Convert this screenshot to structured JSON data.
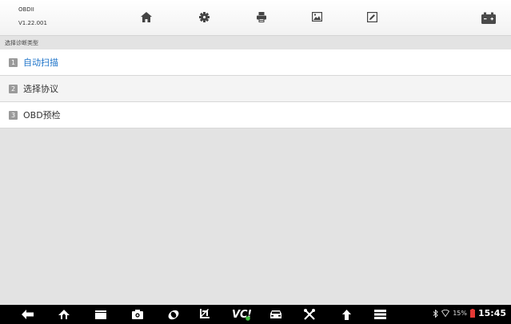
{
  "header": {
    "app_name": "OBDII",
    "app_version": "V1.22.001",
    "toolbar": [
      {
        "icon": "home-icon"
      },
      {
        "icon": "settings-icon"
      },
      {
        "icon": "print-icon"
      },
      {
        "icon": "screenshot-icon"
      },
      {
        "icon": "edit-note-icon"
      }
    ],
    "battery_icon": "vehicle-battery-icon"
  },
  "subtitle": "选择诊断类型",
  "menu": {
    "items": [
      {
        "num": "1",
        "label": "自动扫描",
        "active": true
      },
      {
        "num": "2",
        "label": "选择协议",
        "active": false
      },
      {
        "num": "3",
        "label": "OBD预检",
        "active": false
      }
    ]
  },
  "statusbar": {
    "battery": "15%",
    "time": "15:45"
  },
  "colors": {
    "accent": "#1d73c9",
    "background": "#e3e3e3",
    "navbar": "#000000",
    "battery_low": "#e53935"
  }
}
